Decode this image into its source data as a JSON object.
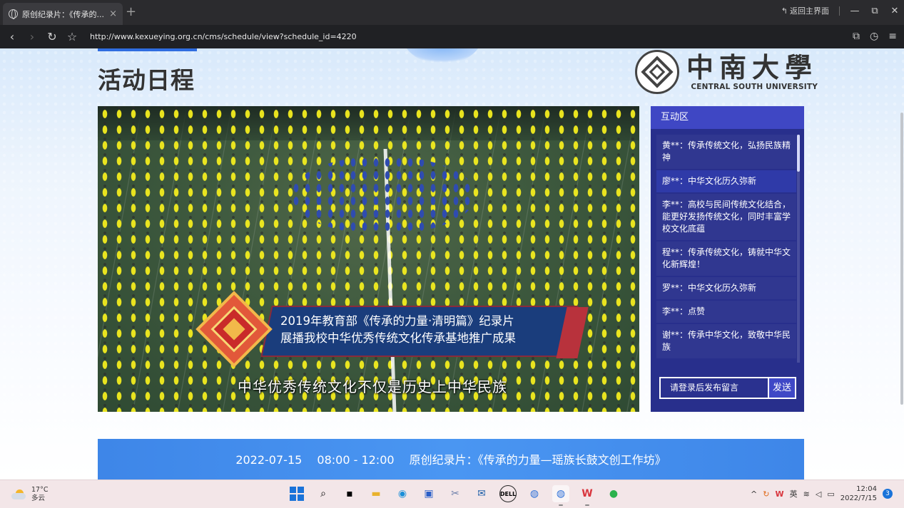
{
  "browser": {
    "tab_title": "原创纪录片：《传承的...",
    "tab_close": "×",
    "new_tab": "+",
    "back_to_main": "返回主界面",
    "window_controls": [
      "—",
      "⧉",
      "✕"
    ],
    "url": "http://www.kexueying.org.cn/cms/schedule/view?schedule_id=4220"
  },
  "page": {
    "heading": "活动日程",
    "logo_cn": "中南大學",
    "logo_en": "CENTRAL SOUTH UNIVERSITY"
  },
  "video": {
    "banner_line1": "2019年教育部《传承的力量·清明篇》纪录片",
    "banner_line2": "展播我校中华优秀传统文化传承基地推广成果",
    "subtitle": "中华优秀传统文化不仅是历史上中华民族"
  },
  "interaction": {
    "title": "互动区",
    "messages": [
      "黄**：传承传统文化，弘扬民族精神",
      "廖**：中华文化历久弥新",
      "李**：高校与民间传统文化结合，能更好发扬传统文化，同时丰富学校文化底蕴",
      "程**：传承传统文化，铸就中华文化新辉煌！",
      "罗**：中华文化历久弥新",
      "李**：点赞",
      "谢**：传承中华文化，致敬中华民族"
    ],
    "input_placeholder": "请登录后发布留言",
    "send_label": "发送"
  },
  "schedule": {
    "date": "2022-07-15",
    "time": "08:00 - 12:00",
    "title": "原创纪录片：《传承的力量—瑶族长鼓文创工作坊》"
  },
  "taskbar": {
    "temperature": "17°C",
    "weather": "多云",
    "ime": "英",
    "time": "12:04",
    "date": "2022/7/15",
    "notifications": "3"
  }
}
